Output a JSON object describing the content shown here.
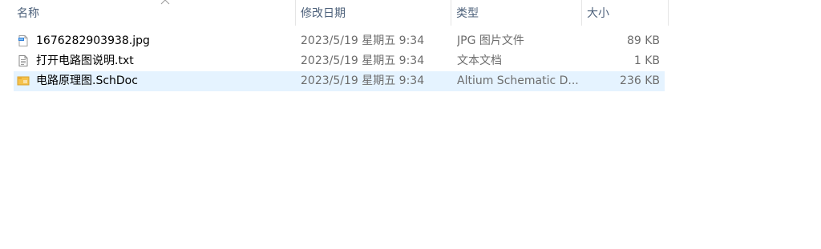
{
  "columns": {
    "name": "名称",
    "date": "修改日期",
    "type": "类型",
    "size": "大小"
  },
  "sort": {
    "column": "name",
    "direction": "ascending",
    "icon": "chevron-up-icon"
  },
  "files": [
    {
      "icon": "image-file-icon",
      "name": "1676282903938.jpg",
      "date": "2023/5/19 星期五 9:34",
      "type": "JPG 图片文件",
      "size": "89 KB",
      "selected": false
    },
    {
      "icon": "text-file-icon",
      "name": "打开电路图说明.txt",
      "date": "2023/5/19 星期五 9:34",
      "type": "文本文档",
      "size": "1 KB",
      "selected": false
    },
    {
      "icon": "schdoc-file-icon",
      "name": "电路原理图.SchDoc",
      "date": "2023/5/19 星期五 9:34",
      "type": "Altium Schematic D...",
      "size": "236 KB",
      "selected": true
    }
  ],
  "colors": {
    "header_text": "#4c607a",
    "selection": "#e5f3ff",
    "detail_text": "#6d6d6d"
  }
}
